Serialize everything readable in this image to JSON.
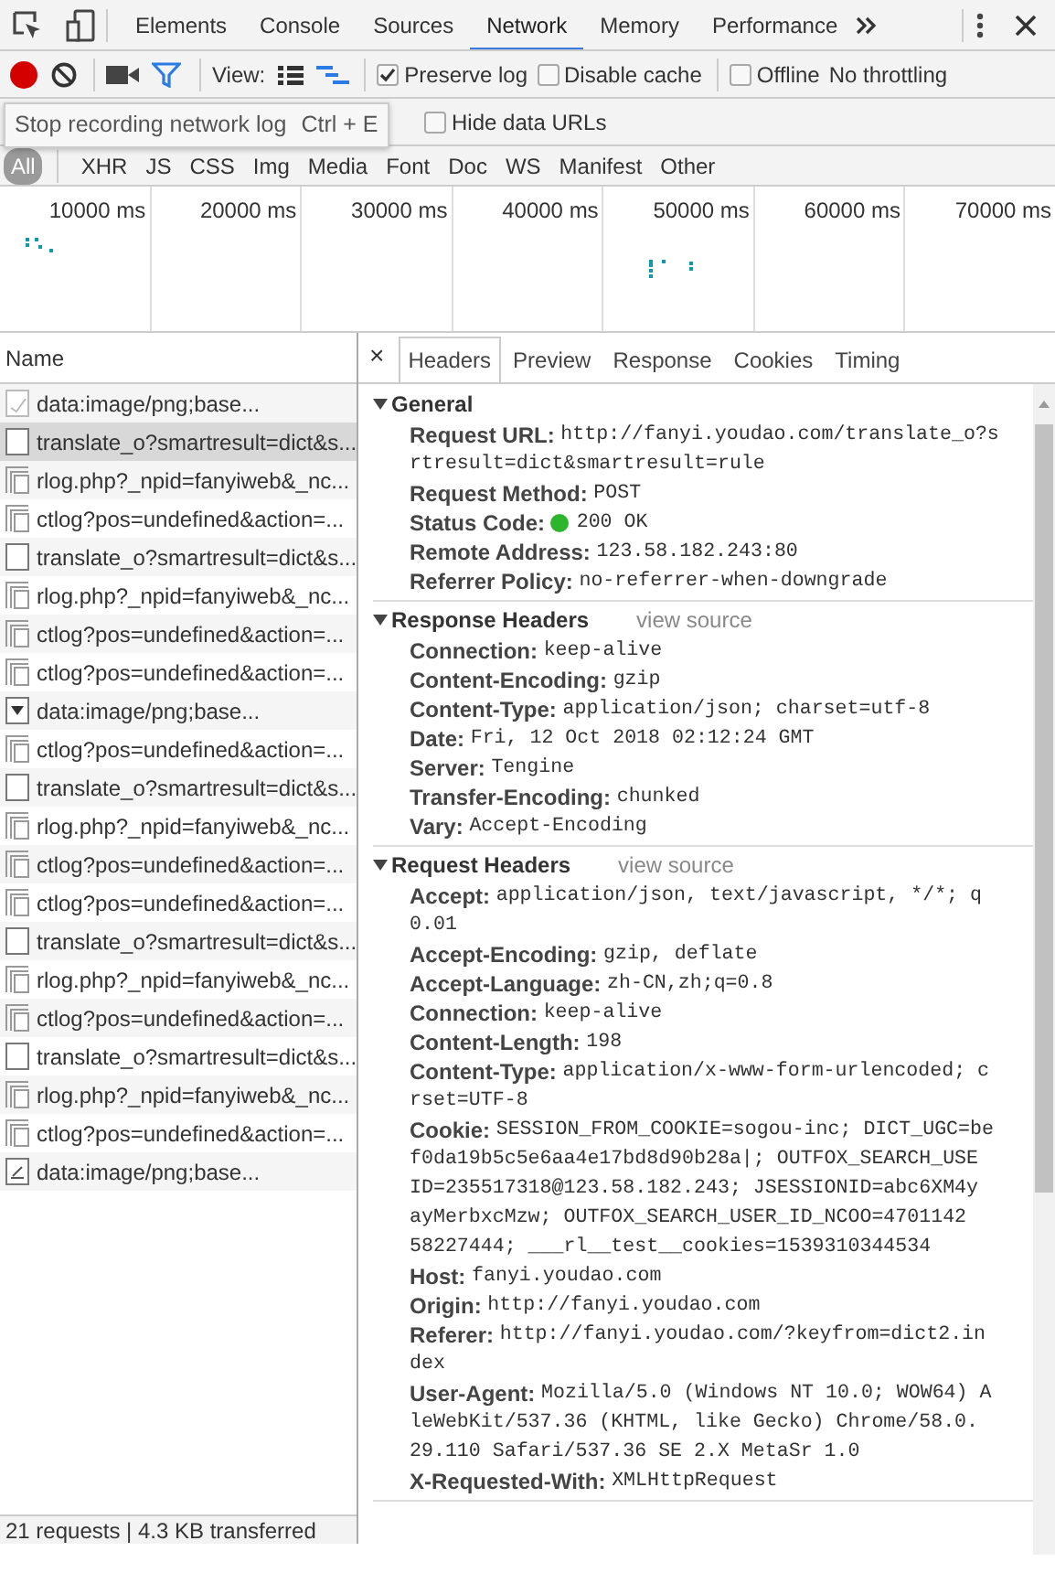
{
  "devtools_tabs": [
    {
      "label": "Elements",
      "selected": false
    },
    {
      "label": "Console",
      "selected": false
    },
    {
      "label": "Sources",
      "selected": false
    },
    {
      "label": "Network",
      "selected": true
    },
    {
      "label": "Memory",
      "selected": false
    },
    {
      "label": "Performance",
      "selected": false
    }
  ],
  "toolbar": {
    "recording": true,
    "view_label": "View:",
    "checkboxes": [
      {
        "label": "Preserve log",
        "checked": true
      },
      {
        "label": "Disable cache",
        "checked": false
      },
      {
        "label": "Offline",
        "checked": false
      }
    ],
    "throttling": "No throttling"
  },
  "tooltip": {
    "text": "Stop recording network log",
    "shortcut": "Ctrl + E"
  },
  "filter_bar": {
    "hide_data_urls": {
      "label": "Hide data URLs",
      "checked": false
    }
  },
  "type_filters": [
    {
      "label": "All",
      "selected": true
    },
    {
      "label": "XHR",
      "selected": false
    },
    {
      "label": "JS",
      "selected": false
    },
    {
      "label": "CSS",
      "selected": false
    },
    {
      "label": "Img",
      "selected": false
    },
    {
      "label": "Media",
      "selected": false
    },
    {
      "label": "Font",
      "selected": false
    },
    {
      "label": "Doc",
      "selected": false
    },
    {
      "label": "WS",
      "selected": false
    },
    {
      "label": "Manifest",
      "selected": false
    },
    {
      "label": "Other",
      "selected": false
    }
  ],
  "timeline": {
    "ticks": [
      "10000 ms",
      "20000 ms",
      "30000 ms",
      "40000 ms",
      "50000 ms",
      "60000 ms",
      "70000 ms"
    ]
  },
  "requests": {
    "column": "Name",
    "rows": [
      {
        "name": "data:image/png;base...",
        "kind": "image",
        "selected": false
      },
      {
        "name": "translate_o?smartresult=dict&s...",
        "kind": "blank",
        "selected": true
      },
      {
        "name": "rlog.php?_npid=fanyiweb&_nc...",
        "kind": "stack",
        "selected": false
      },
      {
        "name": "ctlog?pos=undefined&action=...",
        "kind": "stack",
        "selected": false
      },
      {
        "name": "translate_o?smartresult=dict&s...",
        "kind": "blank",
        "selected": false
      },
      {
        "name": "rlog.php?_npid=fanyiweb&_nc...",
        "kind": "stack",
        "selected": false
      },
      {
        "name": "ctlog?pos=undefined&action=...",
        "kind": "stack",
        "selected": false
      },
      {
        "name": "ctlog?pos=undefined&action=...",
        "kind": "stack",
        "selected": false
      },
      {
        "name": "data:image/png;base...",
        "kind": "triangle",
        "selected": false
      },
      {
        "name": "ctlog?pos=undefined&action=...",
        "kind": "stack",
        "selected": false
      },
      {
        "name": "translate_o?smartresult=dict&s...",
        "kind": "blank",
        "selected": false
      },
      {
        "name": "rlog.php?_npid=fanyiweb&_nc...",
        "kind": "stack",
        "selected": false
      },
      {
        "name": "ctlog?pos=undefined&action=...",
        "kind": "stack",
        "selected": false
      },
      {
        "name": "ctlog?pos=undefined&action=...",
        "kind": "stack",
        "selected": false
      },
      {
        "name": "translate_o?smartresult=dict&s...",
        "kind": "blank",
        "selected": false
      },
      {
        "name": "rlog.php?_npid=fanyiweb&_nc...",
        "kind": "stack",
        "selected": false
      },
      {
        "name": "ctlog?pos=undefined&action=...",
        "kind": "stack",
        "selected": false
      },
      {
        "name": "translate_o?smartresult=dict&s...",
        "kind": "blank",
        "selected": false
      },
      {
        "name": "rlog.php?_npid=fanyiweb&_nc...",
        "kind": "stack",
        "selected": false
      },
      {
        "name": "ctlog?pos=undefined&action=...",
        "kind": "stack",
        "selected": false
      },
      {
        "name": "data:image/png;base...",
        "kind": "pen",
        "selected": false
      }
    ]
  },
  "details": {
    "close": "×",
    "tabs": [
      {
        "label": "Headers",
        "selected": true
      },
      {
        "label": "Preview",
        "selected": false
      },
      {
        "label": "Response",
        "selected": false
      },
      {
        "label": "Cookies",
        "selected": false
      },
      {
        "label": "Timing",
        "selected": false
      }
    ],
    "sections": [
      {
        "title": "General",
        "expanded": true,
        "headers": [
          {
            "name": "Request URL:",
            "lines": [
              "http://fanyi.youdao.com/translate_o?s",
              "rtresult=dict&smartresult=rule"
            ]
          },
          {
            "name": "Request Method:",
            "lines": [
              "POST"
            ]
          },
          {
            "name": "Status Code:",
            "color": "#2db52d",
            "lines": [
              "200 OK"
            ]
          },
          {
            "name": "Remote Address:",
            "lines": [
              "123.58.182.243:80"
            ]
          },
          {
            "name": "Referrer Policy:",
            "lines": [
              "no-referrer-when-downgrade"
            ]
          }
        ]
      },
      {
        "title": "Response Headers",
        "expanded": true,
        "view_source": "view source",
        "headers": [
          {
            "name": "Connection:",
            "lines": [
              "keep-alive"
            ]
          },
          {
            "name": "Content-Encoding:",
            "lines": [
              "gzip"
            ]
          },
          {
            "name": "Content-Type:",
            "lines": [
              "application/json; charset=utf-8"
            ]
          },
          {
            "name": "Date:",
            "lines": [
              "Fri, 12 Oct 2018 02:12:24 GMT"
            ]
          },
          {
            "name": "Server:",
            "lines": [
              "Tengine"
            ]
          },
          {
            "name": "Transfer-Encoding:",
            "lines": [
              "chunked"
            ]
          },
          {
            "name": "Vary:",
            "lines": [
              "Accept-Encoding"
            ]
          }
        ]
      },
      {
        "title": "Request Headers",
        "expanded": true,
        "view_source": "view source",
        "headers": [
          {
            "name": "Accept:",
            "lines": [
              "application/json, text/javascript, */*; q",
              "0.01"
            ]
          },
          {
            "name": "Accept-Encoding:",
            "lines": [
              "gzip, deflate"
            ]
          },
          {
            "name": "Accept-Language:",
            "lines": [
              "zh-CN,zh;q=0.8"
            ]
          },
          {
            "name": "Connection:",
            "lines": [
              "keep-alive"
            ]
          },
          {
            "name": "Content-Length:",
            "lines": [
              "198"
            ]
          },
          {
            "name": "Content-Type:",
            "lines": [
              "application/x-www-form-urlencoded; c",
              "rset=UTF-8"
            ]
          },
          {
            "name": "Cookie:",
            "lines": [
              "SESSION_FROM_COOKIE=sogou-inc; DICT_UGC=be",
              "f0da19b5c5e6aa4e17bd8d90b28a|; OUTFOX_SEARCH_USE",
              "ID=235517318@123.58.182.243; JSESSIONID=abc6XM4y",
              "ayMerbxcMzw; OUTFOX_SEARCH_USER_ID_NCOO=4701142",
              "58227444; ___rl__test__cookies=1539310344534"
            ]
          },
          {
            "name": "Host:",
            "lines": [
              "fanyi.youdao.com"
            ]
          },
          {
            "name": "Origin:",
            "lines": [
              "http://fanyi.youdao.com"
            ]
          },
          {
            "name": "Referer:",
            "lines": [
              "http://fanyi.youdao.com/?keyfrom=dict2.in",
              "dex"
            ]
          },
          {
            "name": "User-Agent:",
            "lines": [
              "Mozilla/5.0 (Windows NT 10.0; WOW64) A",
              "leWebKit/537.36 (KHTML, like Gecko) Chrome/58.0.",
              "29.110 Safari/537.36 SE 2.X MetaSr 1.0"
            ]
          },
          {
            "name": "X-Requested-With:",
            "lines": [
              "XMLHttpRequest"
            ]
          }
        ]
      }
    ]
  },
  "status_bar": "21 requests | 4.3 KB transferred"
}
